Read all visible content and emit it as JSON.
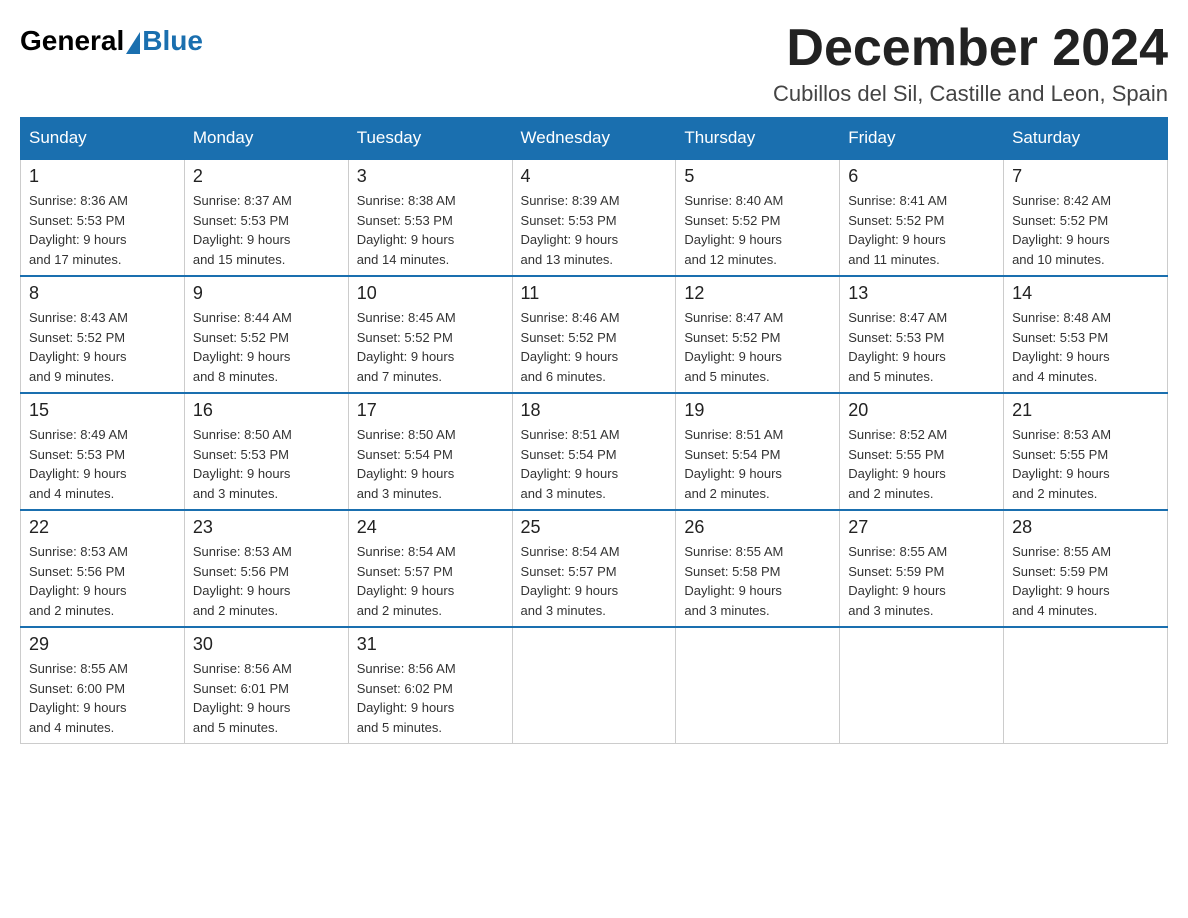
{
  "logo": {
    "general": "General",
    "blue": "Blue"
  },
  "title": "December 2024",
  "subtitle": "Cubillos del Sil, Castille and Leon, Spain",
  "days_of_week": [
    "Sunday",
    "Monday",
    "Tuesday",
    "Wednesday",
    "Thursday",
    "Friday",
    "Saturday"
  ],
  "weeks": [
    [
      {
        "day": "1",
        "sunrise": "8:36 AM",
        "sunset": "5:53 PM",
        "daylight": "9 hours and 17 minutes."
      },
      {
        "day": "2",
        "sunrise": "8:37 AM",
        "sunset": "5:53 PM",
        "daylight": "9 hours and 15 minutes."
      },
      {
        "day": "3",
        "sunrise": "8:38 AM",
        "sunset": "5:53 PM",
        "daylight": "9 hours and 14 minutes."
      },
      {
        "day": "4",
        "sunrise": "8:39 AM",
        "sunset": "5:53 PM",
        "daylight": "9 hours and 13 minutes."
      },
      {
        "day": "5",
        "sunrise": "8:40 AM",
        "sunset": "5:52 PM",
        "daylight": "9 hours and 12 minutes."
      },
      {
        "day": "6",
        "sunrise": "8:41 AM",
        "sunset": "5:52 PM",
        "daylight": "9 hours and 11 minutes."
      },
      {
        "day": "7",
        "sunrise": "8:42 AM",
        "sunset": "5:52 PM",
        "daylight": "9 hours and 10 minutes."
      }
    ],
    [
      {
        "day": "8",
        "sunrise": "8:43 AM",
        "sunset": "5:52 PM",
        "daylight": "9 hours and 9 minutes."
      },
      {
        "day": "9",
        "sunrise": "8:44 AM",
        "sunset": "5:52 PM",
        "daylight": "9 hours and 8 minutes."
      },
      {
        "day": "10",
        "sunrise": "8:45 AM",
        "sunset": "5:52 PM",
        "daylight": "9 hours and 7 minutes."
      },
      {
        "day": "11",
        "sunrise": "8:46 AM",
        "sunset": "5:52 PM",
        "daylight": "9 hours and 6 minutes."
      },
      {
        "day": "12",
        "sunrise": "8:47 AM",
        "sunset": "5:52 PM",
        "daylight": "9 hours and 5 minutes."
      },
      {
        "day": "13",
        "sunrise": "8:47 AM",
        "sunset": "5:53 PM",
        "daylight": "9 hours and 5 minutes."
      },
      {
        "day": "14",
        "sunrise": "8:48 AM",
        "sunset": "5:53 PM",
        "daylight": "9 hours and 4 minutes."
      }
    ],
    [
      {
        "day": "15",
        "sunrise": "8:49 AM",
        "sunset": "5:53 PM",
        "daylight": "9 hours and 4 minutes."
      },
      {
        "day": "16",
        "sunrise": "8:50 AM",
        "sunset": "5:53 PM",
        "daylight": "9 hours and 3 minutes."
      },
      {
        "day": "17",
        "sunrise": "8:50 AM",
        "sunset": "5:54 PM",
        "daylight": "9 hours and 3 minutes."
      },
      {
        "day": "18",
        "sunrise": "8:51 AM",
        "sunset": "5:54 PM",
        "daylight": "9 hours and 3 minutes."
      },
      {
        "day": "19",
        "sunrise": "8:51 AM",
        "sunset": "5:54 PM",
        "daylight": "9 hours and 2 minutes."
      },
      {
        "day": "20",
        "sunrise": "8:52 AM",
        "sunset": "5:55 PM",
        "daylight": "9 hours and 2 minutes."
      },
      {
        "day": "21",
        "sunrise": "8:53 AM",
        "sunset": "5:55 PM",
        "daylight": "9 hours and 2 minutes."
      }
    ],
    [
      {
        "day": "22",
        "sunrise": "8:53 AM",
        "sunset": "5:56 PM",
        "daylight": "9 hours and 2 minutes."
      },
      {
        "day": "23",
        "sunrise": "8:53 AM",
        "sunset": "5:56 PM",
        "daylight": "9 hours and 2 minutes."
      },
      {
        "day": "24",
        "sunrise": "8:54 AM",
        "sunset": "5:57 PM",
        "daylight": "9 hours and 2 minutes."
      },
      {
        "day": "25",
        "sunrise": "8:54 AM",
        "sunset": "5:57 PM",
        "daylight": "9 hours and 3 minutes."
      },
      {
        "day": "26",
        "sunrise": "8:55 AM",
        "sunset": "5:58 PM",
        "daylight": "9 hours and 3 minutes."
      },
      {
        "day": "27",
        "sunrise": "8:55 AM",
        "sunset": "5:59 PM",
        "daylight": "9 hours and 3 minutes."
      },
      {
        "day": "28",
        "sunrise": "8:55 AM",
        "sunset": "5:59 PM",
        "daylight": "9 hours and 4 minutes."
      }
    ],
    [
      {
        "day": "29",
        "sunrise": "8:55 AM",
        "sunset": "6:00 PM",
        "daylight": "9 hours and 4 minutes."
      },
      {
        "day": "30",
        "sunrise": "8:56 AM",
        "sunset": "6:01 PM",
        "daylight": "9 hours and 5 minutes."
      },
      {
        "day": "31",
        "sunrise": "8:56 AM",
        "sunset": "6:02 PM",
        "daylight": "9 hours and 5 minutes."
      },
      null,
      null,
      null,
      null
    ]
  ]
}
